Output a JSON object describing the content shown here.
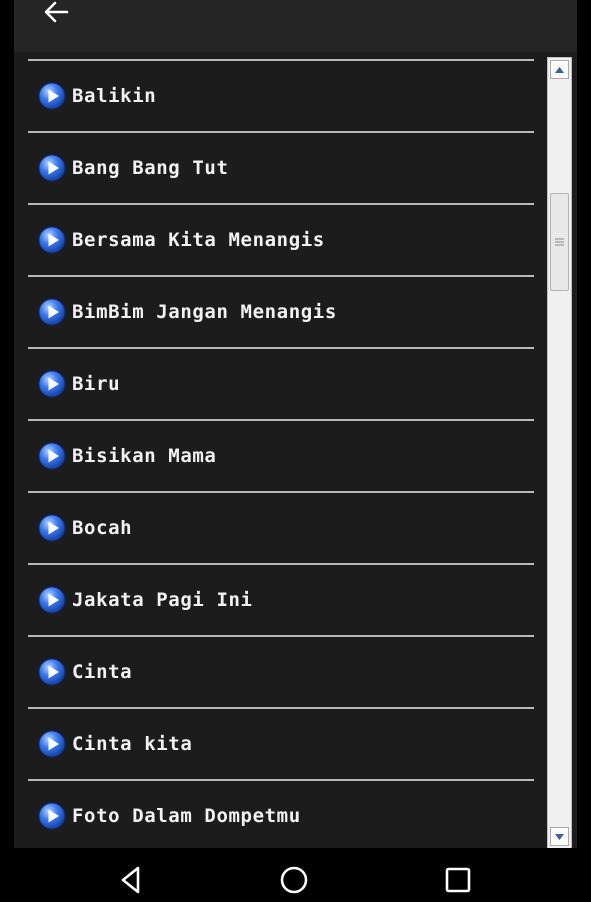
{
  "toolbar": {
    "back_icon": "arrow-left-icon"
  },
  "songs": [
    "Balikin",
    "Bang Bang Tut",
    "Bersama Kita Menangis",
    "BimBim Jangan Menangis",
    "Biru",
    "Bisikan Mama",
    "Bocah",
    "Jakata Pagi Ini",
    "Cinta",
    "Cinta kita",
    "Foto Dalam Dompetmu"
  ],
  "item_icon": "play-circle-icon",
  "colors": {
    "background": "#1c1c1c",
    "toolbar": "#252525",
    "divider": "#b9b9b9",
    "text": "#f2f2f2",
    "play_accent": "#2f6ff0"
  },
  "navbar": {
    "icons": [
      "back-triangle-icon",
      "home-circle-icon",
      "recents-square-icon"
    ]
  }
}
